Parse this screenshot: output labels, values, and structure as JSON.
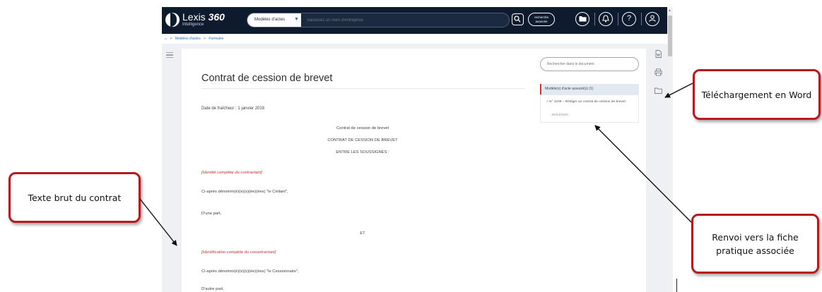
{
  "app": {
    "logo": {
      "name": "Lexis",
      "name_number": "360",
      "sub": "Intelligence"
    },
    "search": {
      "select_value": "Modèles d'actes",
      "placeholder": "Saisissez un nom d'entreprise"
    },
    "advanced_search": {
      "line1": "recherche",
      "line2": "avancée"
    },
    "breadcrumb": [
      "Modèles d'actes",
      "Formules"
    ],
    "document": {
      "title": "Contrat de cession de brevet",
      "freshness": "Date de fraîcheur : 1 janvier 2018",
      "heading1": "Contrat de cession de brevet",
      "heading2": "CONTRAT DE CESSION DE BREVET",
      "heading3": "ENTRE LES SOUSSIGNÉS :",
      "party1_identity": "[Identité complète du contractant]",
      "party1_named": "Ci-après dénomm(é)(e)(s)(ée)(ées) \"le Cédant\",",
      "party1_part": "D'une part,",
      "and": "ET",
      "party2_identity": "[Identification complète du cocontractant]",
      "party2_named": "Ci-après dénomm(é)(e)(s)(ée)(ées) \"le Cessionnaire\",",
      "party2_part": "D'autre part,"
    },
    "side_panel": {
      "search_placeholder": "Rechercher dans le document",
      "associated_header": "Modèle(s) d'acte associé(s) (1)",
      "associated_link": "N° 1249 – Rédiger un contrat de cession de brevet",
      "associated_date": "30/04/2020"
    }
  },
  "callouts": {
    "download": "Téléchargement en Word",
    "raw_text": "Texte brut du contrat",
    "link_sheet": "Renvoi vers la fiche pratique associée"
  },
  "colors": {
    "topbar": "#0e1b2e",
    "accent_red": "#b7191c",
    "link_blue": "#2e6fb5"
  }
}
